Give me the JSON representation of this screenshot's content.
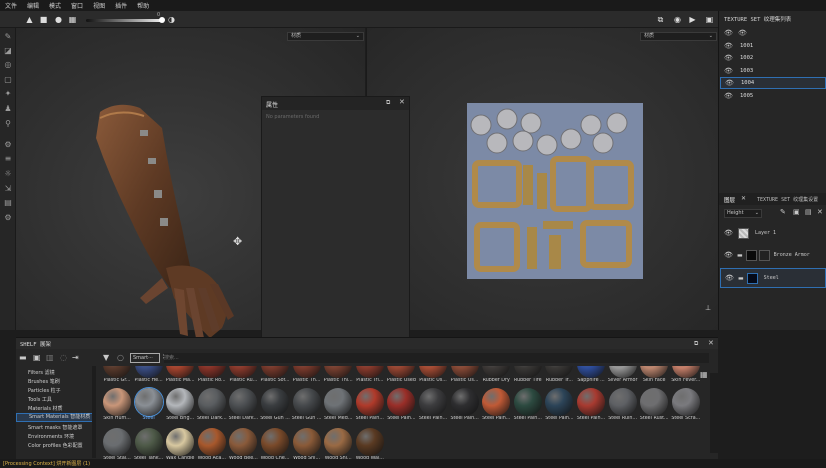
{
  "menu": [
    "文件",
    "编辑",
    "模式",
    "窗口",
    "视图",
    "插件",
    "帮助"
  ],
  "toolbar": {
    "slider_value": "0"
  },
  "viewport3d": {
    "dropdown": "材质"
  },
  "viewport2d": {
    "dropdown": "材质"
  },
  "properties": {
    "title": "属性",
    "empty_text": "No parameters found"
  },
  "texture_sets": {
    "title": "TEXTURE SET 纹理集列表",
    "items": [
      {
        "label": "1001"
      },
      {
        "label": "1002"
      },
      {
        "label": "1003"
      },
      {
        "label": "1004"
      },
      {
        "label": "1005"
      }
    ],
    "selected_index": 3
  },
  "layers": {
    "tab_active": "图层",
    "tab_other": "TEXTURE SET 纹理集设置",
    "channel": "Height",
    "items": [
      {
        "label": "Layer 1"
      },
      {
        "label": "Bronze Armor"
      },
      {
        "label": "Steel"
      }
    ]
  },
  "shelf": {
    "title": "SHELF 展架",
    "search_placeholder": "搜索...",
    "filter_chip": "Smart···",
    "categories": [
      {
        "label": "Filters 滤镜"
      },
      {
        "label": "Brushes 笔刷"
      },
      {
        "label": "Particles 粒子"
      },
      {
        "label": "Tools 工具"
      },
      {
        "label": "Materials 材质"
      },
      {
        "label": "Smart Materials 智能材质"
      },
      {
        "label": "Smart masks 智能遮罩"
      },
      {
        "label": "Environments 环境"
      },
      {
        "label": "Color profiles 色彩配置"
      }
    ],
    "selected_category": 5,
    "row1": [
      {
        "label": "Plastic Gr...",
        "color": "#5a3a2c"
      },
      {
        "label": "Plastic He...",
        "color": "#3a4e86"
      },
      {
        "label": "Plastic Ma...",
        "color": "#a8442e"
      },
      {
        "label": "Plastic Ro...",
        "color": "#8a3328"
      },
      {
        "label": "Plastic Ru...",
        "color": "#8d3a2c"
      },
      {
        "label": "Plastic Sof...",
        "color": "#7a3a2c"
      },
      {
        "label": "Plastic Th...",
        "color": "#7c3a2c"
      },
      {
        "label": "Plastic Thi...",
        "color": "#7a4030"
      },
      {
        "label": "Plastic Tri...",
        "color": "#8a3a2c"
      },
      {
        "label": "Plastic Used",
        "color": "#9a4632"
      },
      {
        "label": "Plastic Us...",
        "color": "#a84c34"
      },
      {
        "label": "Plastic Us...",
        "color": "#8a4a36"
      },
      {
        "label": "Rubber Dry",
        "color": "#3e3a38"
      },
      {
        "label": "Rubber Tire",
        "color": "#3a3836"
      },
      {
        "label": "Rubber Tr...",
        "color": "#3a3836"
      },
      {
        "label": "Sapphire ...",
        "color": "#2e4e9e"
      },
      {
        "label": "Silver Armor",
        "color": "#9a9a9a"
      },
      {
        "label": "Skin Face",
        "color": "#c08870"
      },
      {
        "label": "Skin Fever...",
        "color": "#c8806a"
      }
    ],
    "row2": [
      {
        "label": "Skin Hum...",
        "color": "#c99679"
      },
      {
        "label": "Steel",
        "color": "#8a8f95"
      },
      {
        "label": "Steel Brig...",
        "color": "#b4b7bb"
      },
      {
        "label": "Steel Dark...",
        "color": "#5a5d60"
      },
      {
        "label": "Steel Dark...",
        "color": "#4d5053"
      },
      {
        "label": "Steel Gun ...",
        "color": "#3a3d40"
      },
      {
        "label": "Steel Gun ...",
        "color": "#46494c"
      },
      {
        "label": "Steel Med...",
        "color": "#6e7276"
      },
      {
        "label": "Steel Pain...",
        "color": "#b03a2a"
      },
      {
        "label": "Steel Pain...",
        "color": "#9a2e28"
      },
      {
        "label": "Steel Pain...",
        "color": "#3c3c3e"
      },
      {
        "label": "Steel Pain...",
        "color": "#2e2e30"
      },
      {
        "label": "Steel Pain...",
        "color": "#c05a36"
      },
      {
        "label": "Steel Pain...",
        "color": "#2c4a40"
      },
      {
        "label": "Steel Pain...",
        "color": "#2c4458"
      },
      {
        "label": "Steel Pain...",
        "color": "#a83a30"
      },
      {
        "label": "Steel Ruin...",
        "color": "#5e6064"
      },
      {
        "label": "Steel Rust...",
        "color": "#6e6e70"
      },
      {
        "label": "Steel Scra...",
        "color": "#7a7a7e"
      }
    ],
    "row3": [
      {
        "label": "Steel Stai...",
        "color": "#6a6d70"
      },
      {
        "label": "Steel Tank...",
        "color": "#4e5a48"
      },
      {
        "label": "Wax Candle",
        "color": "#d8c8a0"
      },
      {
        "label": "Wood Aca...",
        "color": "#a8582c"
      },
      {
        "label": "Wood Bee...",
        "color": "#8a5a3a"
      },
      {
        "label": "Wood Che...",
        "color": "#7a4a2a"
      },
      {
        "label": "Wood Shi...",
        "color": "#8a5a38"
      },
      {
        "label": "Wood Shi...",
        "color": "#9a6a44"
      },
      {
        "label": "Wood Wal...",
        "color": "#5a3a22"
      }
    ],
    "selected_material": "Steel"
  },
  "status": {
    "text": "[Processing Context] 烘开新图层 (1)"
  },
  "colors": {
    "accent": "#2f6fb2",
    "bg": "#1d1d1d",
    "panel": "#262626"
  }
}
